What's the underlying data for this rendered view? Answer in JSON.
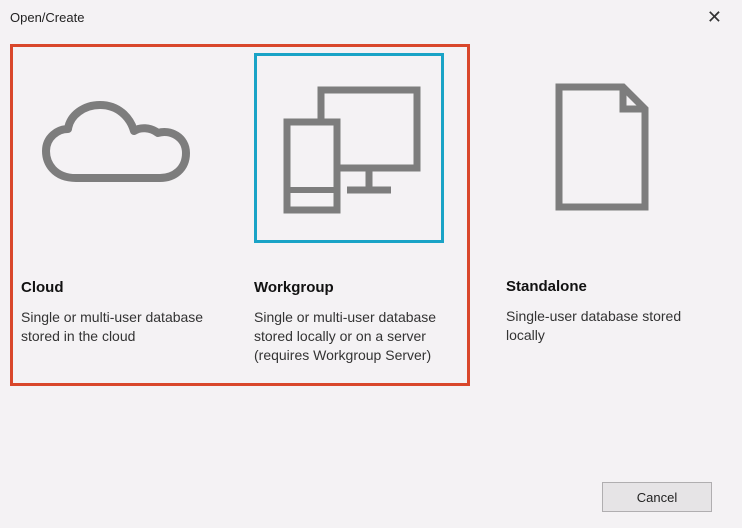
{
  "dialog": {
    "title": "Open/Create"
  },
  "options": {
    "cloud": {
      "title": "Cloud",
      "description": "Single or multi-user database stored in the cloud"
    },
    "workgroup": {
      "title": "Workgroup",
      "description": "Single or multi-user database stored locally or on a server (requires Workgroup Server)"
    },
    "standalone": {
      "title": "Standalone",
      "description": "Single-user database stored locally"
    }
  },
  "buttons": {
    "cancel": "Cancel",
    "close_glyph": "✕"
  }
}
